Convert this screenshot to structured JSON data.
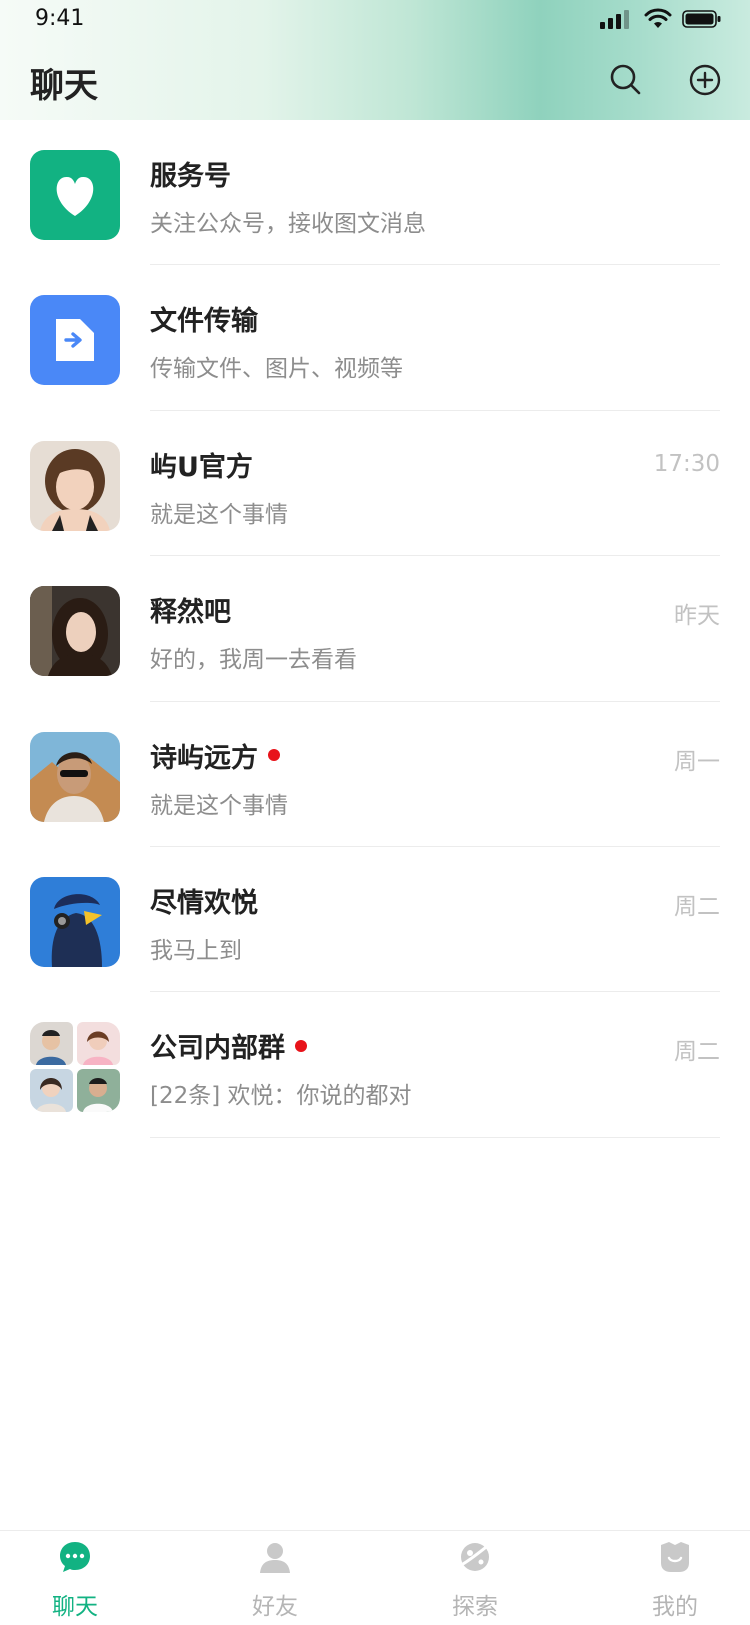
{
  "status_bar": {
    "time": "9:41"
  },
  "header": {
    "title": "聊天"
  },
  "chats": [
    {
      "name": "服务号",
      "preview": "关注公众号，接收图文消息",
      "time": "",
      "unread": false,
      "avatar": "heart-icon"
    },
    {
      "name": "文件传输",
      "preview": "传输文件、图片、视频等",
      "time": "",
      "unread": false,
      "avatar": "file-transfer-icon"
    },
    {
      "name": "屿U官方",
      "preview": "就是这个事情",
      "time": "17:30",
      "unread": false,
      "avatar": "photo"
    },
    {
      "name": "释然吧",
      "preview": "好的，我周一去看看",
      "time": "昨天",
      "unread": false,
      "avatar": "photo"
    },
    {
      "name": "诗屿远方",
      "preview": "就是这个事情",
      "time": "周一",
      "unread": true,
      "avatar": "photo"
    },
    {
      "name": "尽情欢悦",
      "preview": "我马上到",
      "time": "周二",
      "unread": false,
      "avatar": "photo"
    },
    {
      "name": "公司内部群",
      "preview": "[22条] 欢悦：你说的都对",
      "time": "周二",
      "unread": true,
      "avatar": "group-photo"
    }
  ],
  "tabs": [
    {
      "label": "聊天",
      "icon": "chat-bubble-icon",
      "active": true
    },
    {
      "label": "好友",
      "icon": "person-icon",
      "active": false
    },
    {
      "label": "探索",
      "icon": "planet-icon",
      "active": false
    },
    {
      "label": "我的",
      "icon": "face-icon",
      "active": false
    }
  ],
  "colors": {
    "accent": "#12b282",
    "service_avatar": "#12b282",
    "file_avatar": "#4a88f7",
    "unread_dot": "#e8131a"
  }
}
